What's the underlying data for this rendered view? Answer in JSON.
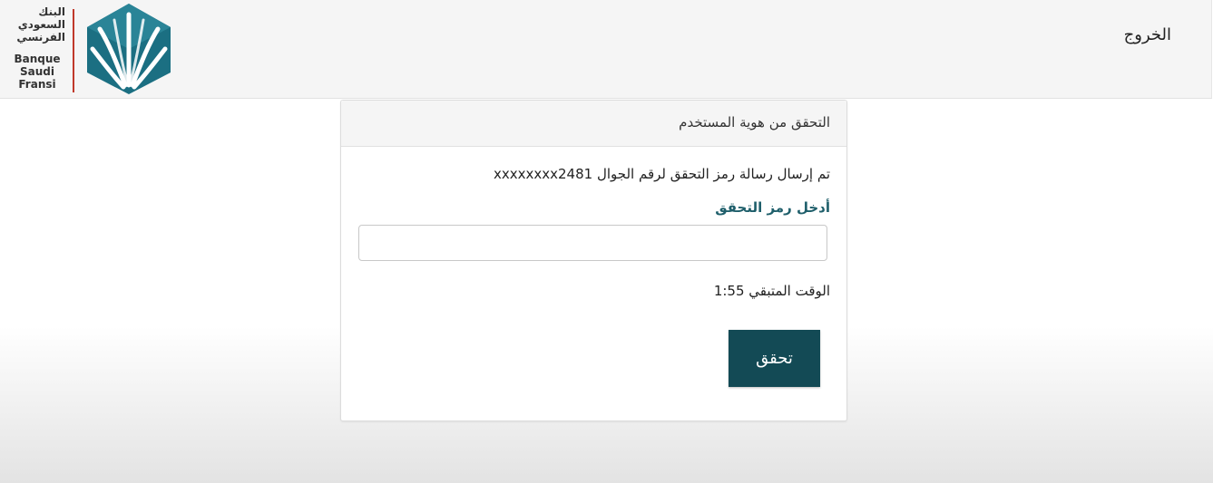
{
  "header": {
    "logout_label": "الخروج",
    "logo": {
      "name_ar": "البنك السعودي الفرنسي",
      "name_fr_line1": "Banque",
      "name_fr_line2": "Saudi",
      "name_fr_line3": "Fransi",
      "brand_color": "#1b6f82",
      "divider_color": "#c0392b"
    }
  },
  "verification": {
    "title": "التحقق من هوية المستخدم",
    "sent_message": "تم إرسال رسالة رمز التحقق لرقم الجوال xxxxxxxx2481",
    "code_label": "أدخل رمز التحقق",
    "code_value": "",
    "timer_label": "الوقت المتبقي 1:55",
    "submit_label": "تحقق",
    "submit_color": "#134a55",
    "label_color": "#1f5f6b"
  }
}
